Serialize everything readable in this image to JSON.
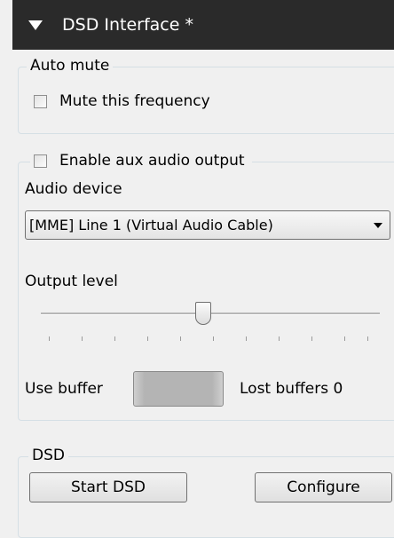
{
  "header": {
    "title": "DSD Interface *"
  },
  "auto_mute": {
    "legend": "Auto mute",
    "mute_label": "Mute this frequency",
    "mute_checked": false
  },
  "aux_audio": {
    "enable_label": "Enable aux audio output",
    "enable_checked": false,
    "audio_device_label": "Audio device",
    "audio_device_value": "[MME] Line 1 (Virtual Audio Cable)",
    "output_level_label": "Output level",
    "output_level": 0.48,
    "use_buffer_label": "Use buffer",
    "lost_buffers_label": "Lost buffers 0"
  },
  "dsd": {
    "legend": "DSD",
    "start_label": "Start DSD",
    "configure_label": "Configure"
  }
}
